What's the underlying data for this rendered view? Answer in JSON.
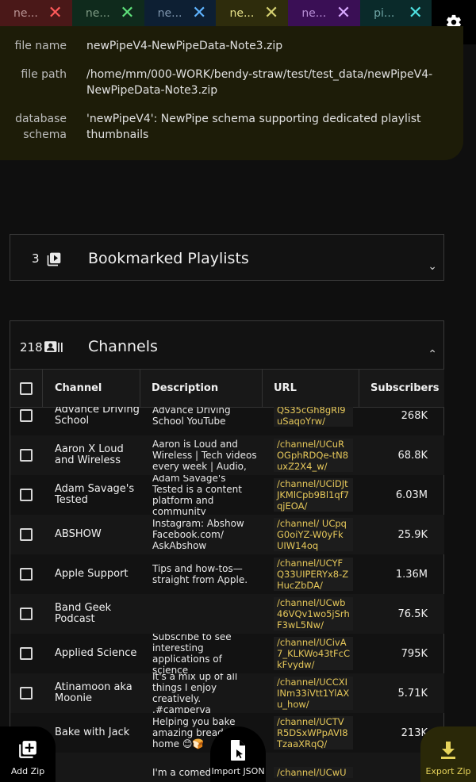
{
  "tabs": [
    {
      "label": "ne...",
      "bg": "#4a1818",
      "fg": "#b89494",
      "x_color": "#ff5a5a"
    },
    {
      "label": "ne...",
      "bg": "#0f2a1c",
      "fg": "#7e9a84",
      "x_color": "#5ee07a"
    },
    {
      "label": "ne...",
      "bg": "#0d1f33",
      "fg": "#7f96ae",
      "x_color": "#5fb4ff"
    },
    {
      "label": "ne...",
      "bg": "#2e2c0c",
      "fg": "#e8e38a",
      "x_color": "#d4d070"
    },
    {
      "label": "ne...",
      "bg": "#3a0f55",
      "fg": "#b88fd6",
      "x_color": "#d8a8ff"
    },
    {
      "label": "pi...",
      "bg": "#0a2a2a",
      "fg": "#6fa5a5",
      "x_color": "#4ee0e0"
    }
  ],
  "info": {
    "file_name_label": "file name",
    "file_name": "newPipeV4-NewPipeData-Note3.zip",
    "file_path_label": "file path",
    "file_path": "/home/mm/000-WORK/bendy-straw/test/test_data/newPipeV4-NewPipeData-Note3.zip",
    "schema_label": "database schema",
    "schema": "'newPipeV4': NewPipe schema supporting dedicated playlist thumbnails"
  },
  "bookmarked": {
    "count": "3",
    "title": "Bookmarked Playlists"
  },
  "channels": {
    "count": "218",
    "title": "Channels",
    "columns": {
      "channel": "Channel",
      "description": "Description",
      "url": "URL",
      "subscribers": "Subscribers"
    },
    "rows": [
      {
        "channel": "Advance Driving School",
        "description": "Advance Driving School YouTube",
        "url": "QS35cGh8gRl9uSaqoYrw/",
        "subs": "268K"
      },
      {
        "channel": "Aaron X Loud and Wireless",
        "description": "Aaron is Loud and Wireless | Tech videos every week | Audio,",
        "url": "/channel/UCuROGphRDQe-tN8uxZ2X4_w/",
        "subs": "68.8K"
      },
      {
        "channel": "Adam Savage's Tested",
        "description": "Adam Savage's Tested is a content platform and community",
        "url": "/channel/UCiDJtJKMlCpb9Bl1qf7qjEOA/",
        "subs": "6.03M"
      },
      {
        "channel": "ABSHOW",
        "description": "Instagram: Abshow Facebook.com/ AskAbshow",
        "url": "/channel/ UCpqG0oiYZ-W0yFkUIW14oq",
        "subs": "25.9K"
      },
      {
        "channel": "Apple Support",
        "description": "Tips and how-tos—straight from Apple.",
        "url": "/channel/UCYFQ33UIPERYx8-ZHucZbDA/",
        "subs": "1.36M"
      },
      {
        "channel": "Band Geek Podcast",
        "description": "",
        "url": "/channel/UCwb46VQv1wo5jSrhF3wL5Nw/",
        "subs": "76.5K"
      },
      {
        "channel": "Applied Science",
        "description": "Subscribe to see interesting applications of science",
        "url": "/channel/UCivA7_KLKWo43tFcCkFvydw/",
        "subs": "795K"
      },
      {
        "channel": "Atinamoon aka Moonie",
        "description": "It's a mix up of all things I enjoy creatively. .#camperva",
        "url": "/channel/UCCXIINm33iVtt1YlAXu_how/",
        "subs": "5.71K"
      },
      {
        "channel": "Bake with Jack",
        "description": "Helping you bake amazing bread at home 😊🍞",
        "url": "/channel/UCTVR5DSxWPpAVI8TzaaXRqQ/",
        "subs": "213K"
      },
      {
        "channel": "",
        "description": "I'm a comedi",
        "url": "/channel/UCwU",
        "subs": ""
      }
    ]
  },
  "bottom": {
    "add_zip": "Add Zip",
    "import_json": "Import JSON",
    "export_zip": "Export Zip"
  }
}
